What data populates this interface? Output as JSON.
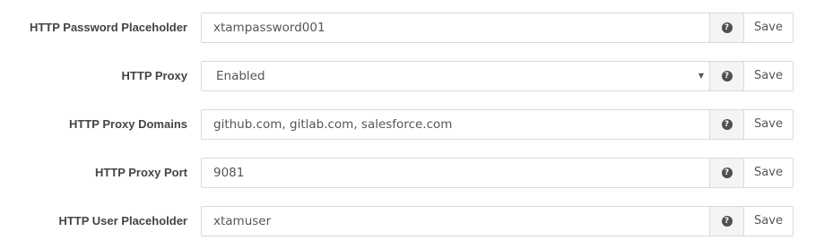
{
  "settings": [
    {
      "label": "HTTP Password Placeholder",
      "value": "xtampassword001",
      "type": "text",
      "save_label": "Save",
      "help_icon": "question-circle-icon"
    },
    {
      "label": "HTTP Proxy",
      "value": "Enabled",
      "type": "select",
      "save_label": "Save",
      "help_icon": "question-circle-icon"
    },
    {
      "label": "HTTP Proxy Domains",
      "value": "github.com, gitlab.com, salesforce.com",
      "type": "text",
      "save_label": "Save",
      "help_icon": "question-circle-icon"
    },
    {
      "label": "HTTP Proxy Port",
      "value": "9081",
      "type": "text",
      "save_label": "Save",
      "help_icon": "question-circle-icon"
    },
    {
      "label": "HTTP User Placeholder",
      "value": "xtamuser",
      "type": "text",
      "save_label": "Save",
      "help_icon": "question-circle-icon"
    }
  ],
  "help_glyph": "?",
  "select_caret": "▼"
}
